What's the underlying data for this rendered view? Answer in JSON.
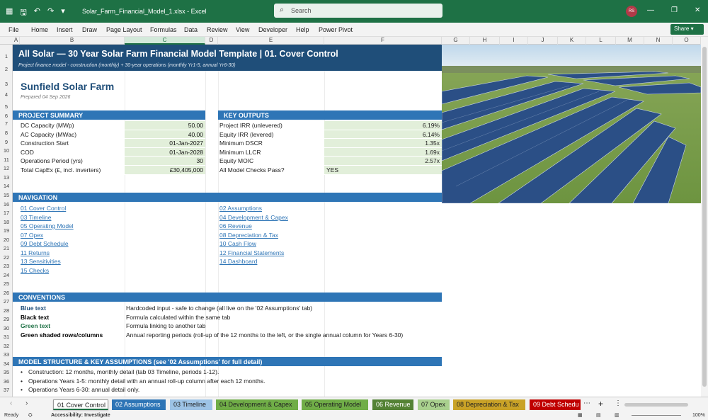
{
  "window": {
    "doc_title": "Solar_Farm_Financial_Model_1.xlsx  -  Excel",
    "search_placeholder": "Search",
    "avatar_initials": "RS",
    "brand_color": "#1e7145"
  },
  "menu": [
    "File",
    "Home",
    "Insert",
    "Draw",
    "Page Layout",
    "Formulas",
    "Data",
    "Review",
    "View",
    "Developer",
    "Help",
    "Power Pivot"
  ],
  "share_label": "Share",
  "columns": [
    "A",
    "B",
    "C",
    "D",
    "E",
    "F",
    "G",
    "H",
    "I",
    "J",
    "K",
    "L",
    "M",
    "N",
    "O"
  ],
  "rows": [
    "1",
    "2",
    "3",
    "4",
    "5",
    "6",
    "7",
    "8",
    "9",
    "10",
    "11",
    "12",
    "13",
    "14",
    "15",
    "16",
    "17",
    "18",
    "19",
    "20",
    "21",
    "22",
    "23",
    "24",
    "25",
    "26",
    "27",
    "28",
    "29",
    "30",
    "31",
    "32",
    "33",
    "34",
    "35",
    "36",
    "37"
  ],
  "banner": {
    "title": "All Solar  —  30 Year Solar Farm Financial Model Template | 01. Cover Control",
    "subtitle": "Project finance model - construction (monthly) + 30-year operations (monthly Yr1-5, annual Yr6-30)"
  },
  "project": {
    "name": "Sunfield Solar Farm",
    "prepared": "Prepared 04 Sep 2026"
  },
  "summary": {
    "header": "PROJECT SUMMARY",
    "rows": [
      {
        "label": "DC Capacity (MWp)",
        "value": "50.00"
      },
      {
        "label": "AC Capacity (MWac)",
        "value": "40.00"
      },
      {
        "label": "Construction Start",
        "value": "01-Jan-2027"
      },
      {
        "label": "COD",
        "value": "01-Jan-2028"
      },
      {
        "label": "Operations Period (yrs)",
        "value": "30"
      },
      {
        "label": "Total CapEx (£, incl. inverters)",
        "value": "£30,405,000"
      }
    ]
  },
  "outputs": {
    "header": "KEY OUTPUTS",
    "rows": [
      {
        "label": "Project IRR (unlevered)",
        "value": "6.19%"
      },
      {
        "label": "Equity IRR (levered)",
        "value": "6.14%"
      },
      {
        "label": "Minimum DSCR",
        "value": "1.35x"
      },
      {
        "label": "Minimum LLCR",
        "value": "1.69x"
      },
      {
        "label": "Equity MOIC",
        "value": "2.57x"
      },
      {
        "label": "All Model Checks Pass?",
        "value": "YES"
      }
    ]
  },
  "navigation": {
    "header": "NAVIGATION",
    "left": [
      "01 Cover Control",
      "03 Timeline",
      "05 Operating Model",
      "07 Opex",
      "09 Debt Schedule",
      "11 Returns",
      "13 Sensitivities",
      "15 Checks"
    ],
    "right": [
      "02 Assumptions",
      "04 Development & Capex",
      "06 Revenue",
      "08 Depreciation & Tax",
      "10 Cash Flow",
      "12 Financial Statements",
      "14 Dashboard"
    ]
  },
  "conventions": {
    "header": "CONVENTIONS",
    "rows": [
      {
        "term": "Blue text",
        "desc": "Hardcoded input - safe to change (all live on the '02 Assumptions' tab)"
      },
      {
        "term": "Black text",
        "desc": "Formula calculated within the same tab"
      },
      {
        "term": "Green text",
        "desc": "Formula linking to another tab"
      },
      {
        "term": "Green shaded rows/columns",
        "desc": "Annual reporting periods (roll-up of the 12 months to the left, or the single annual column for Years 6-30)"
      }
    ]
  },
  "structure": {
    "header": "MODEL STRUCTURE & KEY ASSUMPTIONS (see '02 Assumptions' for full detail)",
    "bullets": [
      "Construction: 12 months, monthly detail (tab 03 Timeline, periods 1-12).",
      "Operations Years 1-5: monthly detail with an annual roll-up column after each 12 months.",
      "Operations Years 6-30: annual detail only."
    ]
  },
  "tabs": [
    {
      "label": "01 Cover Control",
      "color": "#ffffff"
    },
    {
      "label": "02 Assumptions",
      "color": "#2e75b6"
    },
    {
      "label": "03 Timeline",
      "color": "#9dc3e6"
    },
    {
      "label": "04 Development & Capex",
      "color": "#70ad47"
    },
    {
      "label": "05 Operating Model",
      "color": "#70ad47"
    },
    {
      "label": "06 Revenue",
      "color": "#548235"
    },
    {
      "label": "07 Opex",
      "color": "#a9d08e"
    },
    {
      "label": "08 Depreciation & Tax",
      "color": "#c9a227"
    },
    {
      "label": "09 Debt Schedu",
      "color": "#c00000"
    }
  ],
  "status": {
    "ready": "Ready",
    "accessibility": "Accessibility: Investigate",
    "zoom": "100%"
  }
}
